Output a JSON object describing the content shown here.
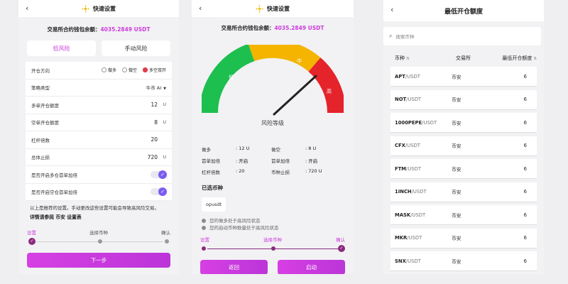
{
  "colors": {
    "accent": "#cc3ddb",
    "brand_yellow": "#f0b90b",
    "gauge_green": "#1dbf4f",
    "gauge_yellow": "#f4b400",
    "gauge_red": "#e5232b"
  },
  "panel1": {
    "back_icon": "back-arrow-icon",
    "title": "快速设置",
    "balance_label": "交易所合约钱包余额：",
    "balance_value": "4035.2849 USDT",
    "risk_tabs": [
      "低风险",
      "手动风险"
    ],
    "rows": {
      "direction": {
        "label": "开仓方向",
        "options": [
          "做多",
          "做空",
          "多空双开"
        ],
        "selected": "多空双开"
      },
      "strategy": {
        "label": "策略类型",
        "value": "牛市 AI"
      },
      "long_amount": {
        "label": "多单开仓额度",
        "value": "12",
        "unit": "U"
      },
      "short_amount": {
        "label": "空单开仓额度",
        "value": "8",
        "unit": "U"
      },
      "leverage": {
        "label": "杠杆倍数",
        "value": "20"
      },
      "stop_loss": {
        "label": "总体止损",
        "value": "720",
        "unit": "U"
      },
      "long_add": {
        "label": "是否开启多仓首单加倍",
        "enabled": true
      },
      "short_add": {
        "label": "是否开启空仓首单加倍",
        "enabled": true
      }
    },
    "note": "以上是推荐的设置。手动更改这些设置可能会导致高风险交易。",
    "note_link": "详情请参阅 币安 设置表",
    "steps": [
      "设置",
      "选择币种",
      "确认"
    ],
    "next_button": "下一步"
  },
  "panel2": {
    "title": "快速设置",
    "balance_label": "交易所合约钱包余额：",
    "balance_value": "4035.2849 USDT",
    "gauge": {
      "segments": [
        "低",
        "中",
        "高"
      ],
      "caption": "风险等级",
      "level": 0.78
    },
    "stats": [
      {
        "label": "做多",
        "value": ": 12 U"
      },
      {
        "label": "做空",
        "value": ": 8 U"
      },
      {
        "label": "首单加倍",
        "value": ": 开启"
      },
      {
        "label": "首单加倍",
        "value": ": 开启"
      },
      {
        "label": "杠杆倍数",
        "value": ": 20"
      },
      {
        "label": "币种止损",
        "value": ": 720 U"
      }
    ],
    "selected_title": "已选币种",
    "selected_coin": "opusdt",
    "bullets": [
      "您的做多处于高风险状态",
      "您的启动币种数量处于高风险状态"
    ],
    "steps": [
      "设置",
      "选择币种",
      "确认"
    ],
    "back_button": "返回",
    "start_button": "启动"
  },
  "panel3": {
    "title": "最低开仓额度",
    "search_placeholder": "搜索币种",
    "headers": {
      "coin": "币种",
      "exchange": "交易所",
      "min": "最低开仓额度"
    },
    "rows": [
      {
        "sym": "APT",
        "quote": "/USDT",
        "exchange": "币安",
        "min": "6"
      },
      {
        "sym": "NOT",
        "quote": "/USDT",
        "exchange": "币安",
        "min": "6"
      },
      {
        "sym": "1000PEPE",
        "quote": "/USDT",
        "exchange": "币安",
        "min": "6"
      },
      {
        "sym": "CFX",
        "quote": "/USDT",
        "exchange": "币安",
        "min": "6"
      },
      {
        "sym": "FTM",
        "quote": "/USDT",
        "exchange": "币安",
        "min": "6"
      },
      {
        "sym": "1INCH",
        "quote": "/USDT",
        "exchange": "币安",
        "min": "6"
      },
      {
        "sym": "MASK",
        "quote": "/USDT",
        "exchange": "币安",
        "min": "6"
      },
      {
        "sym": "MKR",
        "quote": "/USDT",
        "exchange": "币安",
        "min": "6"
      },
      {
        "sym": "SNX",
        "quote": "/USDT",
        "exchange": "币安",
        "min": "6"
      }
    ]
  }
}
